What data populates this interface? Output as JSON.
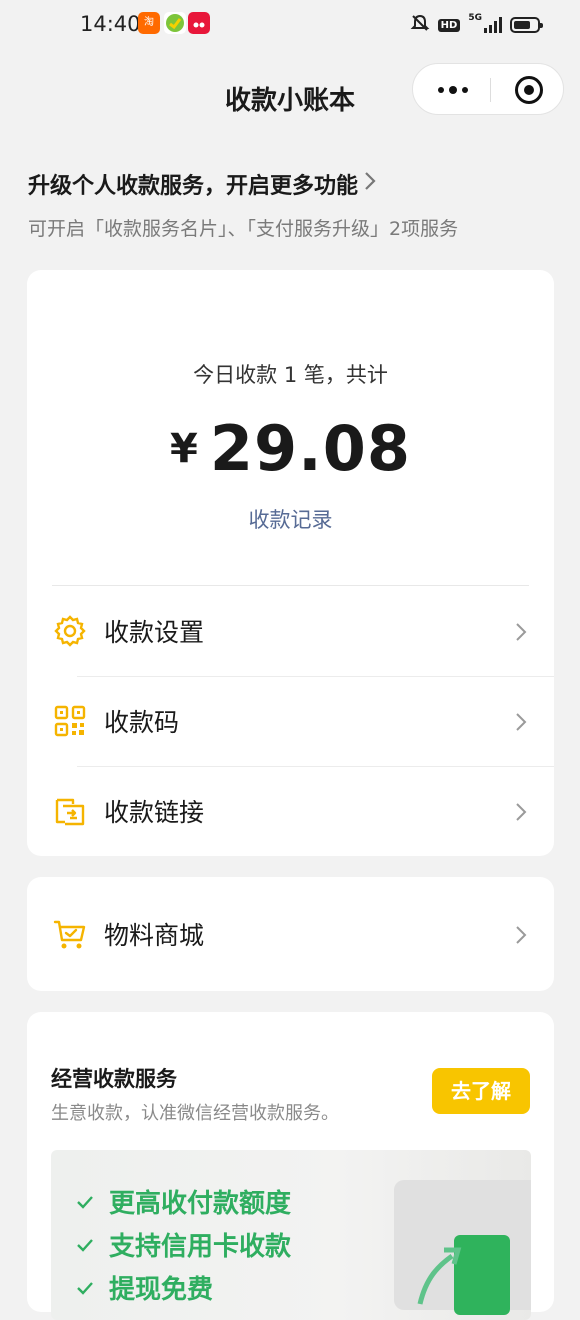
{
  "status_bar": {
    "time": "14:40",
    "app_icons": [
      {
        "name": "taobao-icon",
        "glyph": "淘",
        "color": "#ff5a00"
      },
      {
        "name": "green-app-icon",
        "glyph": "",
        "color": "#7dc53a"
      },
      {
        "name": "tmall-icon",
        "glyph": "",
        "color": "#e8173a"
      }
    ],
    "network": "5G",
    "hd_label": "HD"
  },
  "nav": {
    "title": "收款小账本"
  },
  "upgrade": {
    "title": "升级个人收款服务，开启更多功能",
    "subtitle": "可开启「收款服务名片」、「支付服务升级」2项服务"
  },
  "summary": {
    "today_text": "今日收款 1 笔，共计",
    "currency": "¥",
    "amount": "29.08",
    "records_link": "收款记录"
  },
  "menu": {
    "settings_label": "收款设置",
    "qrcode_label": "收款码",
    "link_label": "收款链接",
    "shop_label": "物料商城"
  },
  "service": {
    "title": "经营收款服务",
    "subtitle": "生意收款，认准微信经营收款服务。",
    "button": "去了解",
    "features": [
      "更高收付款额度",
      "支持信用卡收款",
      "提现免费"
    ]
  },
  "colors": {
    "accent_yellow": "#f8c500",
    "icon_yellow": "#f5b400",
    "link_blue": "#576b95",
    "feature_green": "#2fae60"
  }
}
